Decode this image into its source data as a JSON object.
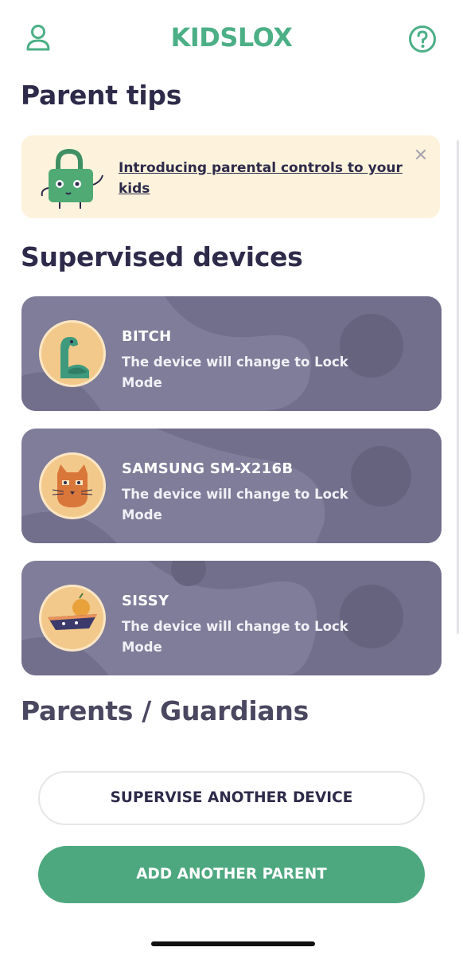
{
  "header": {
    "logo": "KIDSLOX",
    "profile_icon": "user-icon",
    "help_icon": "question-circle-icon"
  },
  "tips": {
    "title": "Parent tips",
    "card_text": "Introducing parental controls to your kids",
    "close_icon": "close-icon",
    "mascot_icon": "padlock-mascot-icon"
  },
  "devices": {
    "title": "Supervised devices",
    "items": [
      {
        "name": "BITCH",
        "status": "The device will change to Lock Mode",
        "avatar": "dinosaur-avatar-icon"
      },
      {
        "name": "SAMSUNG SM-X216B",
        "status": "The device will change to Lock Mode",
        "avatar": "cat-avatar-icon"
      },
      {
        "name": "SISSY",
        "status": "The device will change to Lock Mode",
        "avatar": "boat-avatar-icon"
      }
    ]
  },
  "parents": {
    "title": "Parents / Guardians"
  },
  "actions": {
    "supervise_label": "SUPERVISE ANOTHER DEVICE",
    "add_parent_label": "ADD ANOTHER PARENT"
  },
  "colors": {
    "brand_green": "#4ea87f",
    "card_purple": "#7f7d99",
    "tip_bg": "#fdf3dc",
    "text_dark": "#2d2a4a"
  }
}
